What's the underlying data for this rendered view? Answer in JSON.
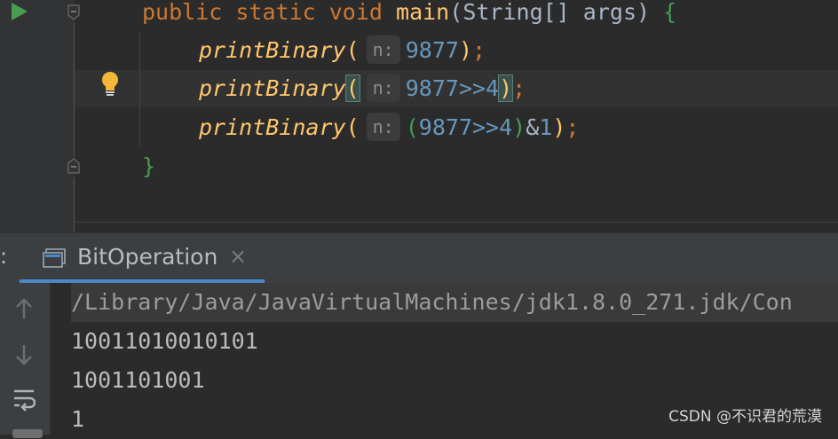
{
  "editor": {
    "line1": {
      "kw_public": "public",
      "kw_static": "static",
      "kw_void": "void",
      "method": "main",
      "open_paren": "(",
      "param_type": "String[]",
      "param_name": "args",
      "close_paren": ")",
      "open_brace": "{"
    },
    "line2": {
      "call": "printBinary",
      "open": "(",
      "hint": "n:",
      "arg": "9877",
      "close": ")",
      "semi": ";"
    },
    "line3": {
      "call": "printBinary",
      "open": "(",
      "hint": "n:",
      "arg_a": "9877>>4",
      "close": ")",
      "semi": ";"
    },
    "line4": {
      "call": "printBinary",
      "open": "(",
      "hint": "n:",
      "paren_open": "(",
      "arg_num": "9877>>4",
      "paren_close": ")",
      "amp": "&",
      "one": "1",
      "close": ")",
      "semi": ";"
    },
    "line5": {
      "close_brace": "}"
    }
  },
  "run_window": {
    "prefix": ":",
    "tab_label": "BitOperation",
    "tab_close": "×"
  },
  "console": {
    "command": "/Library/Java/JavaVirtualMachines/jdk1.8.0_271.jdk/Con",
    "outputs": [
      "10011010010101",
      "1001101001",
      "1"
    ]
  },
  "watermark": "CSDN @不识君的荒漠"
}
